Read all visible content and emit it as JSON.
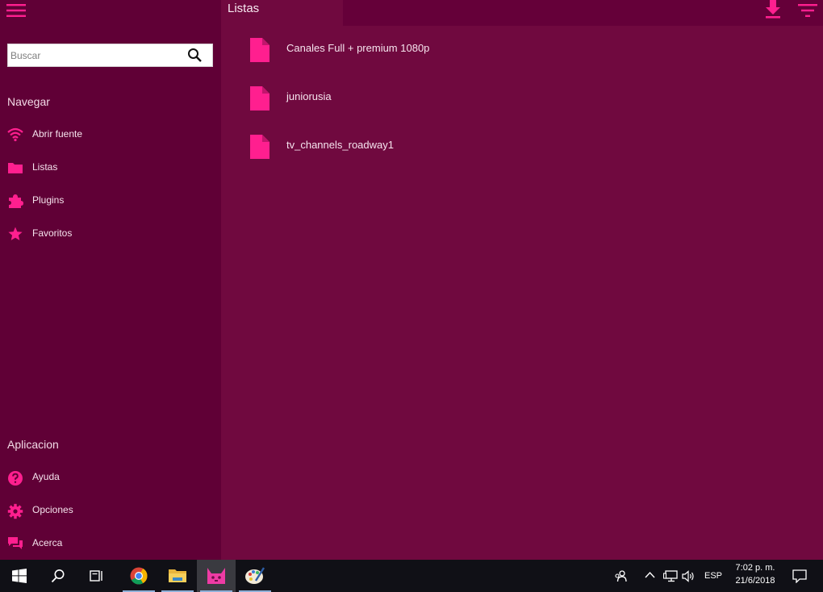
{
  "colors": {
    "accent": "#ff1f8f",
    "sidebar_bg": "#600036",
    "content_bg": "#70093f",
    "topbar_bg": "#650039"
  },
  "header": {
    "title": "Listas",
    "menu_icon": "hamburger-icon",
    "actions": [
      "download-icon",
      "filter-icon"
    ]
  },
  "sidebar": {
    "search": {
      "placeholder": "Buscar",
      "value": ""
    },
    "navigate_title": "Navegar",
    "nav_items": [
      {
        "label": "Abrir fuente",
        "icon": "wifi-icon"
      },
      {
        "label": "Listas",
        "icon": "folder-icon"
      },
      {
        "label": "Plugins",
        "icon": "puzzle-icon"
      },
      {
        "label": "Favoritos",
        "icon": "star-icon"
      }
    ],
    "app_title": "Aplicacion",
    "app_items": [
      {
        "label": "Ayuda",
        "icon": "help-icon"
      },
      {
        "label": "Opciones",
        "icon": "gear-icon"
      },
      {
        "label": "Acerca",
        "icon": "chat-icon"
      }
    ]
  },
  "main": {
    "lists": [
      {
        "name": "Canales Full + premium 1080p",
        "icon": "file-icon"
      },
      {
        "name": "juniorusia",
        "icon": "file-icon"
      },
      {
        "name": "tv_channels_roadway1",
        "icon": "file-icon"
      }
    ]
  },
  "taskbar": {
    "apps": [
      "windows-start-icon",
      "search-icon",
      "task-view-icon",
      "chrome-icon",
      "file-explorer-icon",
      "iptv-app-icon",
      "paint-icon"
    ],
    "language": "ESP",
    "time": "7:02 p. m.",
    "date": "21/6/2018"
  }
}
